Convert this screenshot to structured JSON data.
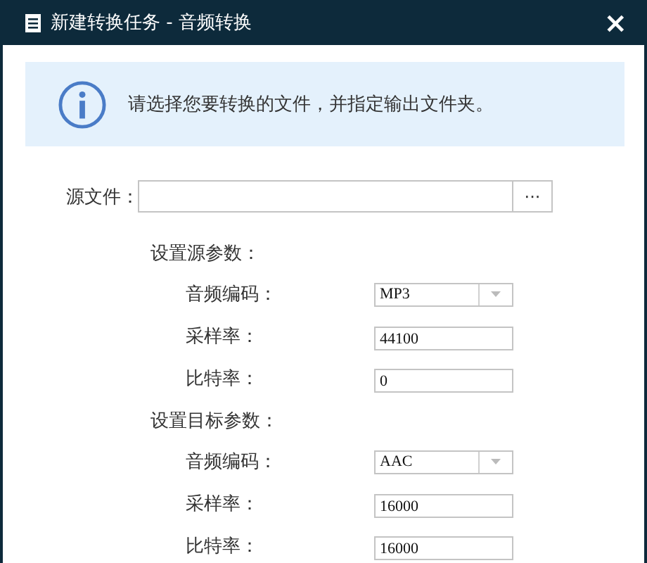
{
  "window": {
    "title": "新建转换任务 - 音频转换",
    "close": "×"
  },
  "info": {
    "message": "请选择您要转换的文件，并指定输出文件夹。"
  },
  "source_file": {
    "label": "源文件：",
    "browse": "···"
  },
  "sections": [
    {
      "heading": "设置源参数：",
      "rows": [
        {
          "kind": "select",
          "label": "音频编码：",
          "value": "MP3"
        },
        {
          "kind": "text",
          "label": "采样率：",
          "value": "44100"
        },
        {
          "kind": "text",
          "label": "比特率：",
          "value": "0"
        }
      ]
    },
    {
      "heading": "设置目标参数：",
      "rows": [
        {
          "kind": "select",
          "label": "音频编码：",
          "value": "AAC"
        },
        {
          "kind": "text",
          "label": "采样率：",
          "value": "16000"
        },
        {
          "kind": "text",
          "label": "比特率：",
          "value": "16000"
        }
      ]
    }
  ]
}
